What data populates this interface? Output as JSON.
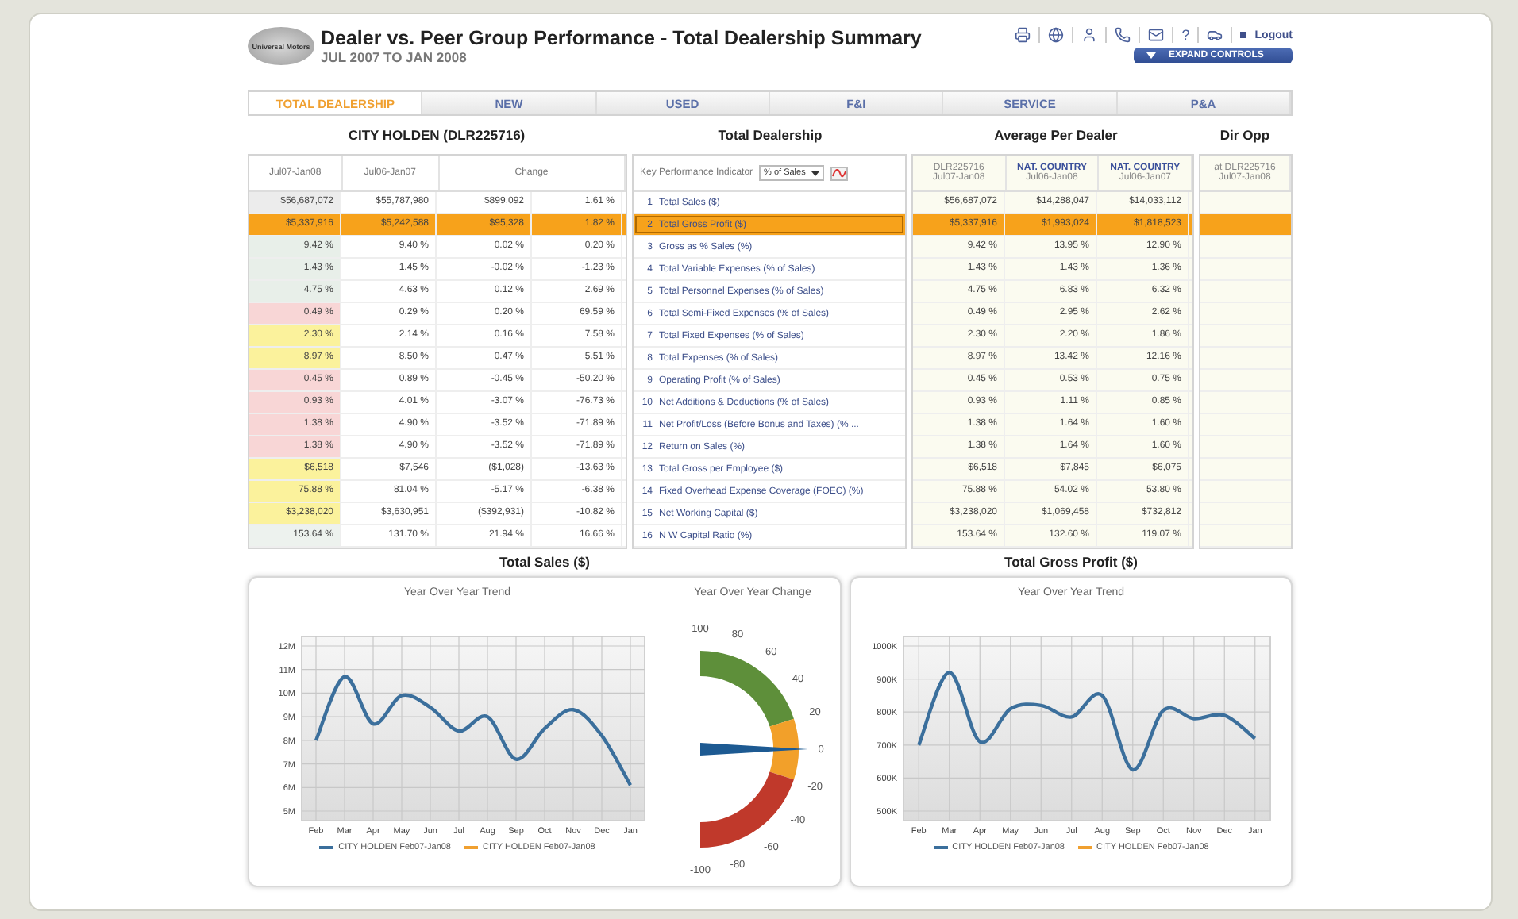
{
  "header": {
    "logo_text": "Universal Motors",
    "title": "Dealer vs. Peer Group Performance - Total Dealership Summary",
    "subtitle": "JUL 2007 TO JAN 2008",
    "help": "?",
    "logout": "Logout",
    "expand_button": "EXPAND CONTROLS"
  },
  "tabs": [
    {
      "label": "TOTAL DEALERSHIP",
      "selected": true
    },
    {
      "label": "NEW",
      "selected": false
    },
    {
      "label": "USED",
      "selected": false
    },
    {
      "label": "F&I",
      "selected": false
    },
    {
      "label": "SERVICE",
      "selected": false
    },
    {
      "label": "P&A",
      "selected": false
    }
  ],
  "sections": {
    "dealer": "CITY HOLDEN (DLR225716)",
    "kpi": "Total Dealership",
    "average": "Average Per Dealer",
    "dir": "Dir Opp"
  },
  "dealer_columns": [
    "Jul07-Jan08",
    "Jul06-Jan07",
    "Change"
  ],
  "kpi_header": {
    "label": "Key Performance Indicator",
    "select_value": "% of Sales"
  },
  "peer_columns": [
    {
      "name": "DLR225716",
      "period": "Jul07-Jan08",
      "highlight": false
    },
    {
      "name": "NAT. COUNTRY",
      "period": "Jul06-Jan08",
      "highlight": true
    },
    {
      "name": "NAT. COUNTRY",
      "period": "Jul06-Jan07",
      "highlight": true
    }
  ],
  "dir_column": {
    "name": "at DLR225716",
    "period": "Jul07-Jan08"
  },
  "rows": [
    {
      "num": "1",
      "kpi": "Total Sales ($)",
      "selected": false,
      "color": "#ececec",
      "values": [
        "$56,687,072",
        "$55,787,980",
        "$899,092",
        "1.61 %"
      ],
      "peers": [
        "$56,687,072",
        "$14,288,047",
        "$14,033,112"
      ]
    },
    {
      "num": "2",
      "kpi": "Total Gross Profit ($)",
      "selected": true,
      "color": "#f7a21b",
      "values": [
        "$5,337,916",
        "$5,242,588",
        "$95,328",
        "1.82 %"
      ],
      "peers": [
        "$5,337,916",
        "$1,993,024",
        "$1,818,523"
      ]
    },
    {
      "num": "3",
      "kpi": "Gross as % Sales (%)",
      "selected": false,
      "color": "#e8efe9",
      "values": [
        "9.42 %",
        "9.40 %",
        "0.02 %",
        "0.20 %"
      ],
      "peers": [
        "9.42 %",
        "13.95 %",
        "12.90 %"
      ]
    },
    {
      "num": "4",
      "kpi": "Total Variable Expenses (% of Sales)",
      "selected": false,
      "color": "#e8efe9",
      "values": [
        "1.43 %",
        "1.45 %",
        "-0.02 %",
        "-1.23 %"
      ],
      "peers": [
        "1.43 %",
        "1.43 %",
        "1.36 %"
      ]
    },
    {
      "num": "5",
      "kpi": "Total Personnel Expenses (% of Sales)",
      "selected": false,
      "color": "#e8efe9",
      "values": [
        "4.75 %",
        "4.63 %",
        "0.12 %",
        "2.69 %"
      ],
      "peers": [
        "4.75 %",
        "6.83 %",
        "6.32 %"
      ]
    },
    {
      "num": "6",
      "kpi": "Total Semi-Fixed Expenses (% of Sales)",
      "selected": false,
      "color": "#f8d6d6",
      "values": [
        "0.49 %",
        "0.29 %",
        "0.20 %",
        "69.59 %"
      ],
      "peers": [
        "0.49 %",
        "2.95 %",
        "2.62 %"
      ]
    },
    {
      "num": "7",
      "kpi": "Total Fixed Expenses (% of Sales)",
      "selected": false,
      "color": "#fbf29c",
      "values": [
        "2.30 %",
        "2.14 %",
        "0.16 %",
        "7.58 %"
      ],
      "peers": [
        "2.30 %",
        "2.20 %",
        "1.86 %"
      ]
    },
    {
      "num": "8",
      "kpi": "Total Expenses (% of Sales)",
      "selected": false,
      "color": "#fbf29c",
      "values": [
        "8.97 %",
        "8.50 %",
        "0.47 %",
        "5.51 %"
      ],
      "peers": [
        "8.97 %",
        "13.42 %",
        "12.16 %"
      ]
    },
    {
      "num": "9",
      "kpi": "Operating Profit (% of Sales)",
      "selected": false,
      "color": "#f8d6d6",
      "values": [
        "0.45 %",
        "0.89 %",
        "-0.45 %",
        "-50.20 %"
      ],
      "peers": [
        "0.45 %",
        "0.53 %",
        "0.75 %"
      ]
    },
    {
      "num": "10",
      "kpi": "Net Additions & Deductions (% of Sales)",
      "selected": false,
      "color": "#f8d6d6",
      "values": [
        "0.93 %",
        "4.01 %",
        "-3.07 %",
        "-76.73 %"
      ],
      "peers": [
        "0.93 %",
        "1.11 %",
        "0.85 %"
      ]
    },
    {
      "num": "11",
      "kpi": "Net Profit/Loss (Before Bonus and Taxes) (% ...",
      "selected": false,
      "color": "#f8d6d6",
      "values": [
        "1.38 %",
        "4.90 %",
        "-3.52 %",
        "-71.89 %"
      ],
      "peers": [
        "1.38 %",
        "1.64 %",
        "1.60 %"
      ]
    },
    {
      "num": "12",
      "kpi": "Return on Sales (%)",
      "selected": false,
      "color": "#f8d6d6",
      "values": [
        "1.38 %",
        "4.90 %",
        "-3.52 %",
        "-71.89 %"
      ],
      "peers": [
        "1.38 %",
        "1.64 %",
        "1.60 %"
      ]
    },
    {
      "num": "13",
      "kpi": "Total Gross per Employee ($)",
      "selected": false,
      "color": "#fbf29c",
      "values": [
        "$6,518",
        "$7,546",
        "($1,028)",
        "-13.63 %"
      ],
      "peers": [
        "$6,518",
        "$7,845",
        "$6,075"
      ]
    },
    {
      "num": "14",
      "kpi": "Fixed Overhead Expense Coverage (FOEC) (%)",
      "selected": false,
      "color": "#fbf29c",
      "values": [
        "75.88 %",
        "81.04 %",
        "-5.17 %",
        "-6.38 %"
      ],
      "peers": [
        "75.88 %",
        "54.02 %",
        "53.80 %"
      ]
    },
    {
      "num": "15",
      "kpi": "Net Working Capital ($)",
      "selected": false,
      "color": "#fbf29c",
      "values": [
        "$3,238,020",
        "$3,630,951",
        "($392,931)",
        "-10.82 %"
      ],
      "peers": [
        "$3,238,020",
        "$1,069,458",
        "$732,812"
      ]
    },
    {
      "num": "16",
      "kpi": "N W Capital Ratio (%)",
      "selected": false,
      "color": "#edf2ee",
      "values": [
        "153.64 %",
        "131.70 %",
        "21.94 %",
        "16.66 %"
      ],
      "peers": [
        "153.64 %",
        "132.60 %",
        "119.07 %"
      ]
    }
  ],
  "sales_panel": {
    "title": "Total Sales ($)",
    "trend": {
      "subtitle": "Year Over Year Trend",
      "chart_data": {
        "type": "line",
        "categories": [
          "Feb",
          "Mar",
          "Apr",
          "May",
          "Jun",
          "Jul",
          "Aug",
          "Sep",
          "Oct",
          "Nov",
          "Dec",
          "Jan"
        ],
        "series": [
          {
            "name": "CITY HOLDEN Feb07-Jan08",
            "color": "#3b6f9c",
            "values": [
              8.0,
              10.7,
              8.7,
              9.9,
              9.4,
              8.4,
              9.0,
              7.2,
              8.5,
              9.3,
              8.2,
              6.1
            ]
          },
          {
            "name": "CITY HOLDEN Feb07-Jan08",
            "color": "#f0a030",
            "values": [
              null,
              null,
              null,
              null,
              null,
              null,
              null,
              null,
              null,
              null,
              null,
              null
            ]
          }
        ],
        "grid": true,
        "ylim": [
          5,
          12
        ],
        "yticks": [
          {
            "value": 5,
            "label": "5M"
          },
          {
            "value": 6,
            "label": "6M"
          },
          {
            "value": 7,
            "label": "7M"
          },
          {
            "value": 8,
            "label": "8M"
          },
          {
            "value": 9,
            "label": "9M"
          },
          {
            "value": 10,
            "label": "10M"
          },
          {
            "value": 11,
            "label": "11M"
          },
          {
            "value": 12,
            "label": "12M"
          }
        ]
      }
    },
    "gauge": {
      "subtitle": "Year Over Year Change",
      "ticks": [
        "100",
        "80",
        "60",
        "40",
        "20",
        "0",
        "-20",
        "-40",
        "-60",
        "-80",
        "-100"
      ]
    }
  },
  "gross_panel": {
    "title": "Total Gross Profit ($)",
    "trend": {
      "subtitle": "Year Over Year Trend",
      "chart_data": {
        "type": "line",
        "categories": [
          "Feb",
          "Mar",
          "Apr",
          "May",
          "Jun",
          "Jul",
          "Aug",
          "Sep",
          "Oct",
          "Nov",
          "Dec",
          "Jan"
        ],
        "series": [
          {
            "name": "CITY HOLDEN Feb07-Jan08",
            "color": "#3b6f9c",
            "values": [
              700,
              920,
              710,
              810,
              820,
              785,
              850,
              625,
              805,
              780,
              790,
              720
            ]
          },
          {
            "name": "CITY HOLDEN Feb07-Jan08",
            "color": "#f0a030",
            "values": [
              null,
              null,
              null,
              null,
              null,
              null,
              null,
              null,
              null,
              null,
              null,
              null
            ]
          }
        ],
        "grid": true,
        "ylim": [
          500,
          1000
        ],
        "yticks": [
          {
            "value": 500,
            "label": "500K"
          },
          {
            "value": 600,
            "label": "600K"
          },
          {
            "value": 700,
            "label": "700K"
          },
          {
            "value": 800,
            "label": "800K"
          },
          {
            "value": 900,
            "label": "900K"
          },
          {
            "value": 1000,
            "label": "1000K"
          }
        ]
      }
    }
  }
}
